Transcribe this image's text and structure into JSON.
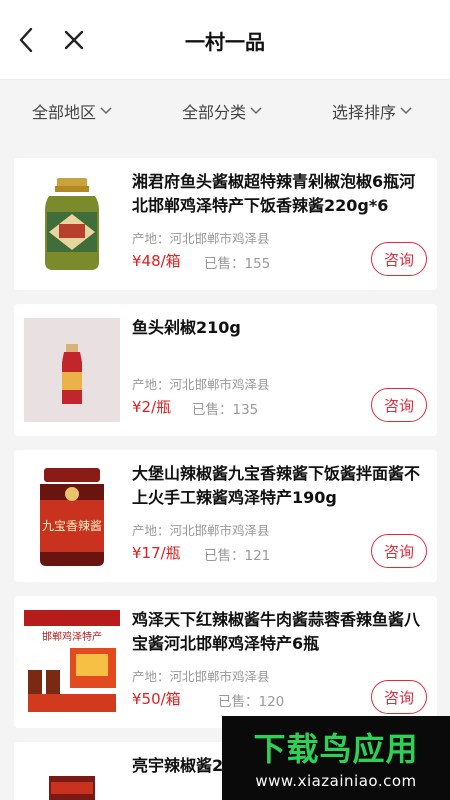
{
  "header": {
    "title": "一村一品"
  },
  "filters": [
    {
      "label": "全部地区"
    },
    {
      "label": "全部分类"
    },
    {
      "label": "选择排序"
    }
  ],
  "products": [
    {
      "name": "湘君府鱼头酱椒超特辣青剁椒泡椒6瓶河北邯郸鸡泽特产下饭香辣酱220g*6",
      "origin": "产地：河北邯郸市鸡泽县",
      "price": "¥48/箱",
      "sold": "已售：155",
      "action": "咨询"
    },
    {
      "name": "鱼头剁椒210g",
      "origin": "产地：河北邯郸市鸡泽县",
      "price": "¥2/瓶",
      "sold": "已售：135",
      "action": "咨询"
    },
    {
      "name": "大堡山辣椒酱九宝香辣酱下饭酱拌面酱不上火手工辣酱鸡泽特产190g",
      "origin": "产地：河北邯郸市鸡泽县",
      "price": "¥17/瓶",
      "sold": "已售：121",
      "action": "咨询",
      "image_text": "九宝香辣酱"
    },
    {
      "name": "鸡泽天下红辣椒酱牛肉酱蒜蓉香辣鱼酱八宝酱河北邯郸鸡泽特产6瓶",
      "origin": "产地：河北邯郸市鸡泽县",
      "price": "¥50/箱",
      "sold": "已售：120",
      "action": "咨询",
      "image_text": "邯郸鸡泽特产"
    },
    {
      "name": "亮宇辣椒酱2"
    }
  ],
  "watermark": {
    "title": "下载鸟应用",
    "url": "www.xiazainiao.com"
  },
  "colors": {
    "price": "#e02020",
    "accent": "#e02b3b",
    "watermark_green": "#2fd058"
  }
}
